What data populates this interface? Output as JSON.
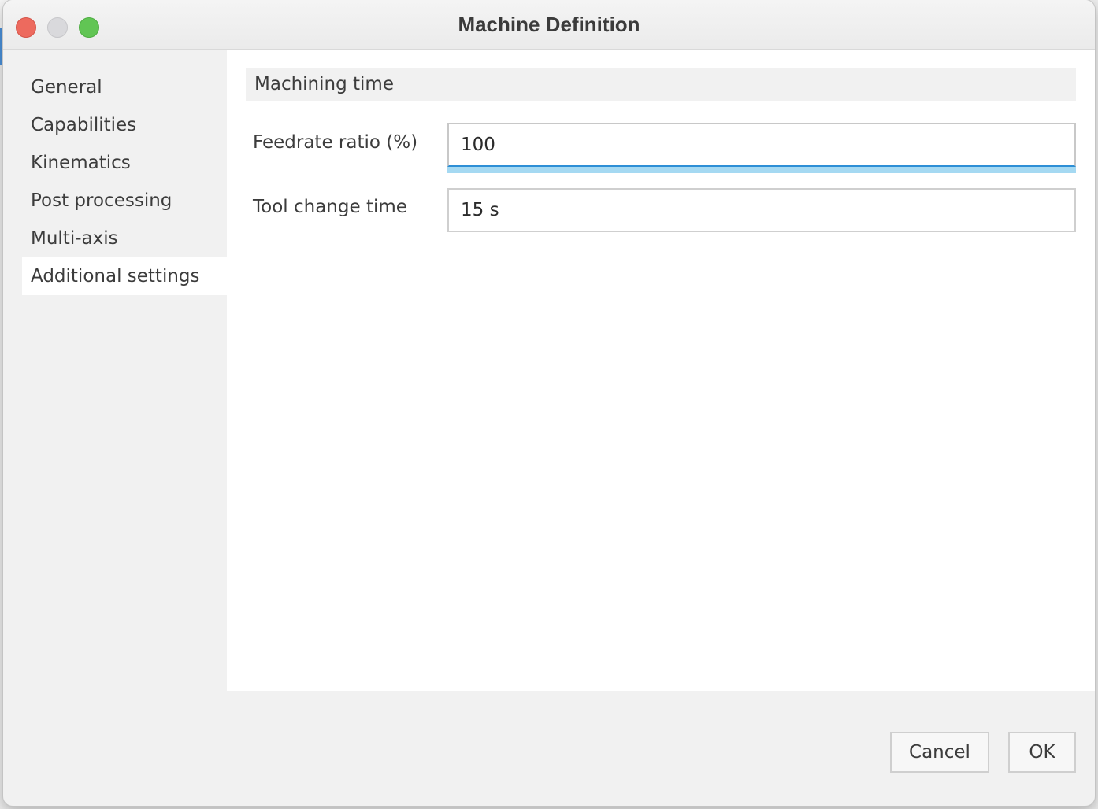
{
  "window": {
    "title": "Machine Definition"
  },
  "sidebar": {
    "items": [
      {
        "label": "General"
      },
      {
        "label": "Capabilities"
      },
      {
        "label": "Kinematics"
      },
      {
        "label": "Post processing"
      },
      {
        "label": "Multi-axis"
      },
      {
        "label": "Additional settings",
        "selected": true
      }
    ]
  },
  "main": {
    "section_title": "Machining time",
    "fields": [
      {
        "label": "Feedrate ratio (%)",
        "value": "100",
        "focused": true
      },
      {
        "label": "Tool change time",
        "value": "15 s"
      }
    ]
  },
  "footer": {
    "cancel_label": "Cancel",
    "ok_label": "OK"
  },
  "colors": {
    "close": "#ed6a5e",
    "minimize": "#d9d9dc",
    "zoom": "#61c554",
    "focus_accent": "#2d8fd6",
    "focus_glow": "#a5d9f2"
  }
}
